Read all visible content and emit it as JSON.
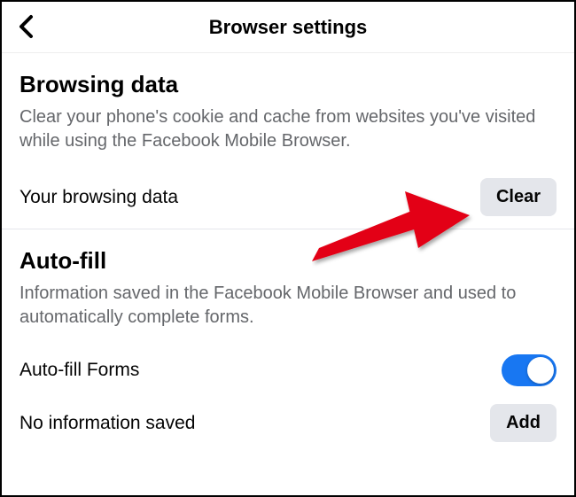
{
  "header": {
    "title": "Browser settings"
  },
  "sections": {
    "browsing_data": {
      "title": "Browsing data",
      "description": "Clear your phone's cookie and cache from websites you've visited while using the Facebook Mobile Browser.",
      "row_label": "Your browsing data",
      "clear_button": "Clear"
    },
    "autofill": {
      "title": "Auto-fill",
      "description": "Information saved in the Facebook Mobile Browser and used to automatically complete forms.",
      "forms_label": "Auto-fill Forms",
      "toggle_on": true,
      "no_info_label": "No information saved",
      "add_button": "Add"
    }
  },
  "colors": {
    "accent": "#1877f2",
    "annotation": "#e30613"
  }
}
